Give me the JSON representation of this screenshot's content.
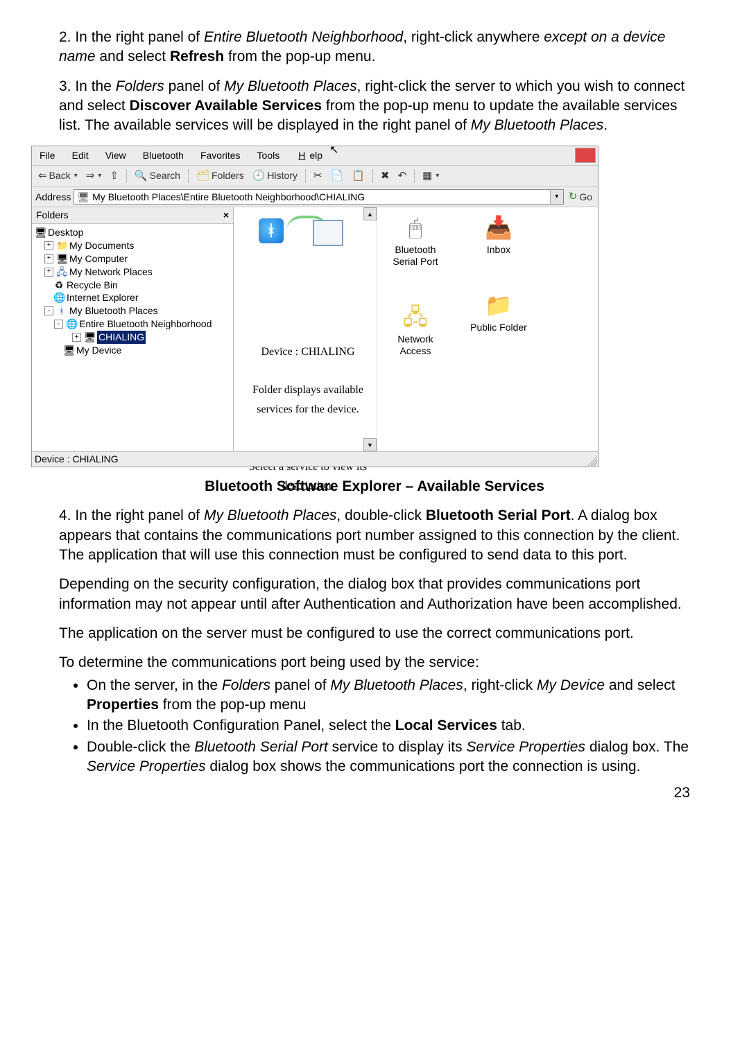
{
  "para2": {
    "lead": "2. In the right panel of ",
    "i1": "Entire Bluetooth Neighborhood",
    "mid1": ", right-click anywhere ",
    "i2": "except on a device name",
    "mid2": " and select ",
    "b1": "Refresh",
    "tail": " from the pop-up menu."
  },
  "para3": {
    "lead": "3. In the ",
    "i1": "Folders",
    "mid1": " panel of ",
    "i2": "My Bluetooth Places",
    "mid2": ", right-click the server to which you wish to connect and select ",
    "b1": "Discover Available Services",
    "mid3": " from the pop-up menu to update the available services list. The available services will be displayed in the right panel of ",
    "i3": "My Bluetooth Places",
    "tail": "."
  },
  "win": {
    "menu": {
      "file": "File",
      "edit": "Edit",
      "view": "View",
      "bluetooth": "Bluetooth",
      "favorites": "Favorites",
      "tools": "Tools",
      "help": "Help"
    },
    "tb": {
      "back": "Back",
      "search": "Search",
      "folders": "Folders",
      "history": "History"
    },
    "addr_label": "Address",
    "addr_value": "My Bluetooth Places\\Entire Bluetooth Neighborhood\\CHIALING",
    "go": "Go",
    "folders_title": "Folders",
    "tree": {
      "desktop": "Desktop",
      "mydocs": "My Documents",
      "mycomp": "My Computer",
      "mynet": "My Network Places",
      "recycle": "Recycle Bin",
      "ie": "Internet Explorer",
      "mybt": "My Bluetooth Places",
      "entire": "Entire Bluetooth Neighborhood",
      "chialing": "CHIALING",
      "mydev": "My Device"
    },
    "mid": {
      "device": "Device : CHIALING",
      "l1": "Folder displays available",
      "l2": "services for the device.",
      "l3": "Select a service to view its",
      "l4": "description."
    },
    "svc": {
      "serial": "Bluetooth Serial Port",
      "inbox": "Inbox",
      "net": "Network Access",
      "pub": "Public Folder"
    },
    "status": "Device : CHIALING"
  },
  "caption": "Bluetooth Software Explorer – Available Services",
  "para4": {
    "lead": "4. In the right panel of ",
    "i1": "My Bluetooth Places",
    "mid1": ", double-click ",
    "b1": "Bluetooth Serial Port",
    "mid2": ". A dialog box appears that contains the communications port number assigned to this connection by the client. The application that will use this connection must be configured to send data to this port."
  },
  "para5": "Depending on the security configuration, the dialog box that provides communications port information may not appear until after Authentication and Authorization have been accomplished.",
  "para6": "The application on the server must be configured to use the correct communications port.",
  "para7": "To determine the communications port being used by the service:",
  "bul1": {
    "a": "On the server, in the ",
    "i1": "Folders",
    "b": " panel of ",
    "i2": "My Bluetooth Places",
    "c": ", right-click ",
    "i3": "My Device",
    "d": " and select ",
    "bold": "Properties",
    "e": " from the pop-up menu"
  },
  "bul2": {
    "a": "In the Bluetooth Configuration Panel, select the ",
    "bold": "Local Services",
    "b": " tab."
  },
  "bul3": {
    "a": "Double-click the ",
    "i1": "Bluetooth Serial Port",
    "b": " service to display its ",
    "i2": "Service Properties",
    "c": " dialog box. The ",
    "i3": "Service Properties",
    "d": " dialog box shows the communications port the connection is using."
  },
  "page": "23"
}
